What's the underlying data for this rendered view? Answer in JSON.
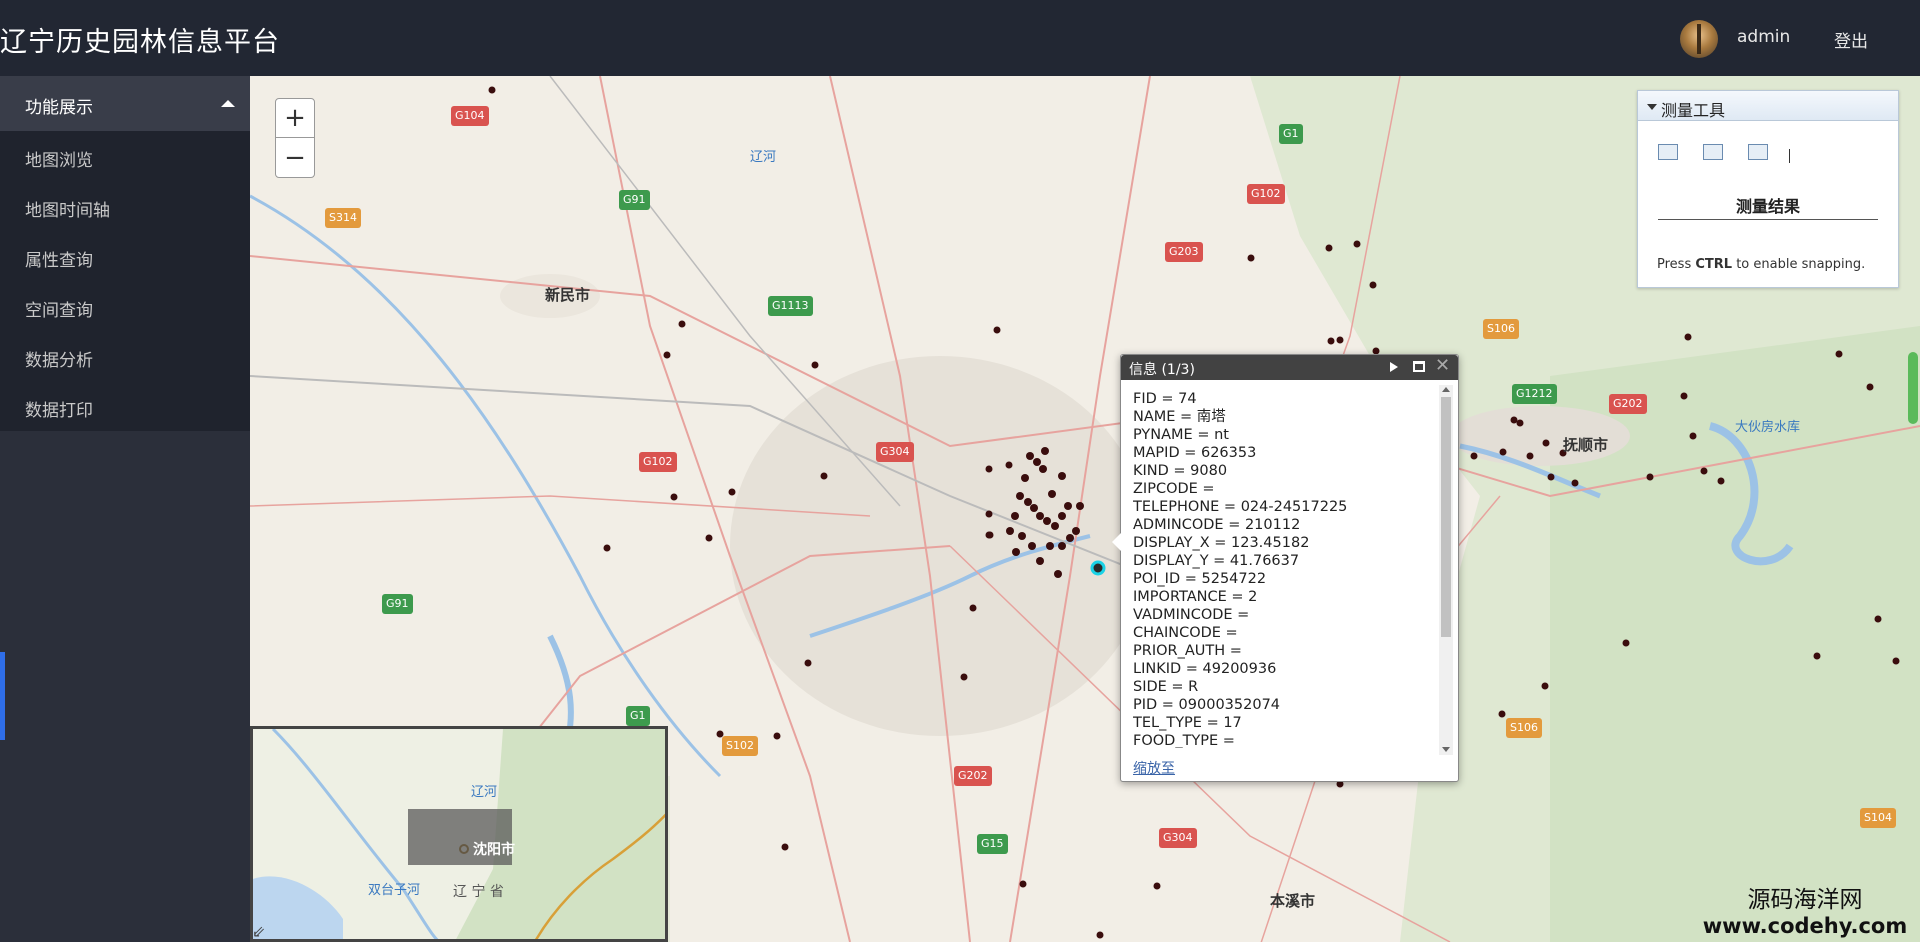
{
  "header": {
    "title": "辽宁历史园林信息平台",
    "user": "admin",
    "logout": "登出"
  },
  "sidebar": {
    "group_label": "功能展示",
    "items": [
      {
        "label": "地图浏览"
      },
      {
        "label": "地图时间轴"
      },
      {
        "label": "属性查询"
      },
      {
        "label": "空间查询"
      },
      {
        "label": "数据分析"
      },
      {
        "label": "数据打印"
      }
    ]
  },
  "map": {
    "zoom_in": "+",
    "zoom_out": "−",
    "labels": {
      "xinmin": "新民市",
      "fushun": "抚顺市",
      "benxi": "本溪市",
      "liaohe": "辽河",
      "dahuofang": "大伙房水库"
    },
    "shields": {
      "g104": "G104",
      "g1_top": "G1",
      "g102_top": "G102",
      "g91_top": "G91",
      "s314": "S314",
      "g203": "G203",
      "g1113": "G1113",
      "s106_top": "S106",
      "g1212": "G1212",
      "g202_right": "G202",
      "g102_left": "G102",
      "g304": "G304",
      "g91_left": "G91",
      "g1_bottom": "G1",
      "s102": "S102",
      "g202_bottom": "G202",
      "g15": "G15",
      "g304_bottom": "G304",
      "s106_bottom": "S106",
      "s104": "S104"
    }
  },
  "measure_tool": {
    "title": "测量工具",
    "result_label": "测量结果",
    "hint_prefix": "Press ",
    "hint_key": "CTRL",
    "hint_suffix": " to enable snapping."
  },
  "popup": {
    "title": "信息 (1/3)",
    "fields": [
      "FID = 74",
      "NAME = 南塔",
      "PYNAME = nt",
      "MAPID = 626353",
      "KIND = 9080",
      "ZIPCODE =",
      "TELEPHONE = 024-24517225",
      "ADMINCODE = 210112",
      "DISPLAY_X = 123.45182",
      "DISPLAY_Y = 41.76637",
      "POI_ID = 5254722",
      "IMPORTANCE = 2",
      "VADMINCODE =",
      "CHAINCODE =",
      "PRIOR_AUTH =",
      "LINKID = 49200936",
      "SIDE = R",
      "PID = 09000352074",
      "TEL_TYPE = 17",
      "FOOD_TYPE ="
    ],
    "zoom_to": "缩放至"
  },
  "overview": {
    "liaohe": "辽河",
    "shenyang": "沈阳市",
    "shuangtaizi": "双台子河",
    "liaoning": "辽 宁 省"
  },
  "watermark": {
    "line1": "源码海洋网",
    "line2": "www.codehy.com"
  }
}
